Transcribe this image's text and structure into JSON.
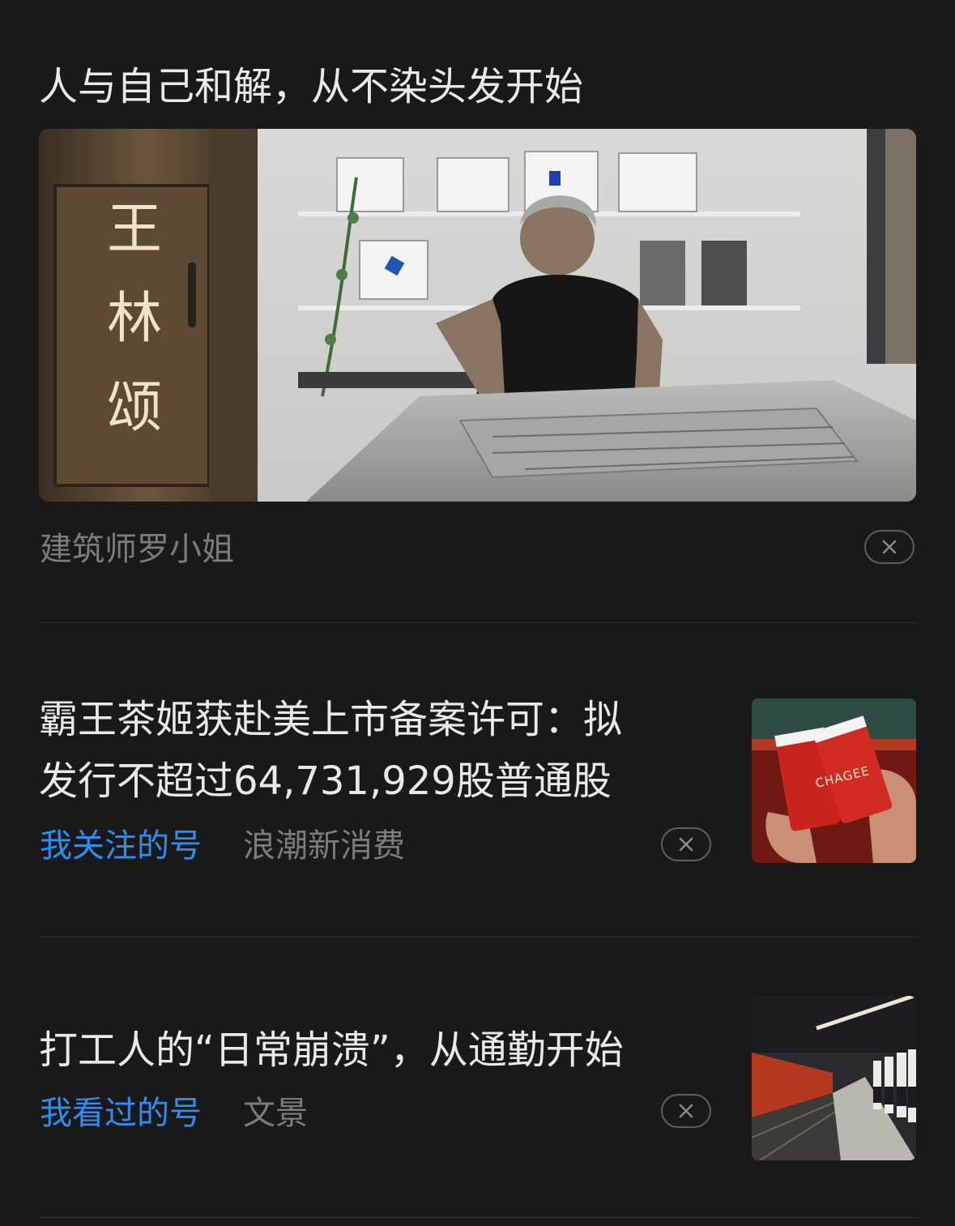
{
  "feed": {
    "articles": [
      {
        "title": "人与自己和解，从不染头发开始",
        "source": "建筑师罗小姐",
        "cover_icon": "architect-at-model-photo",
        "door_sign": "王林颂"
      },
      {
        "title_line1": "霸王茶姬获赴美上市备案许可：拟",
        "title_line2": "发行不超过64,731,929股普通股",
        "tag": "我关注的号",
        "source": "浪潮新消费",
        "thumb_icon": "tea-cups-photo",
        "cup_text": "CHAGEE"
      },
      {
        "title": "打工人的“日常崩溃”，从通勤开始",
        "tag": "我看过的号",
        "source": "文景",
        "thumb_icon": "subway-platform-photo"
      }
    ]
  },
  "colors": {
    "background": "#191919",
    "title_text": "#e9e9e9",
    "source_text": "#7c7c7c",
    "tag_text": "#2f8df0",
    "divider": "#2d2d2d"
  }
}
